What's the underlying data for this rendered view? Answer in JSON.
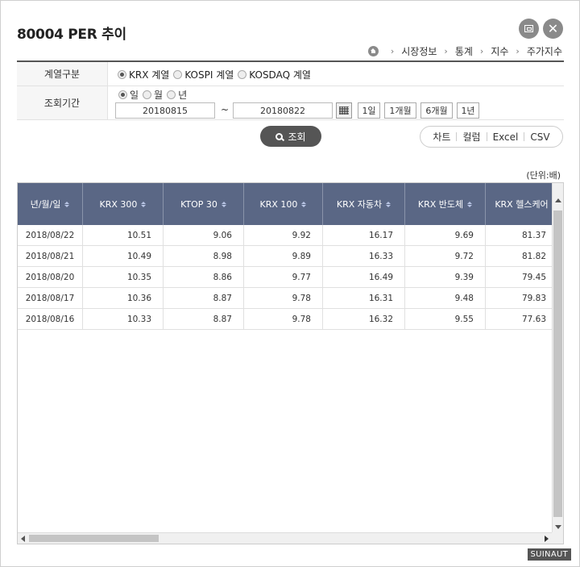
{
  "window": {
    "title": "80004 PER 추이",
    "restore_icon": "restore-icon",
    "close_icon": "close-icon",
    "close_glyph": "✕"
  },
  "breadcrumb": {
    "separator": "›",
    "items": [
      "시장정보",
      "통계",
      "지수",
      "주가지수"
    ]
  },
  "form": {
    "series_label": "계열구분",
    "series_options": [
      {
        "label": "KRX 계열",
        "selected": true
      },
      {
        "label": "KOSPI 계열",
        "selected": false
      },
      {
        "label": "KOSDAQ 계열",
        "selected": false
      }
    ],
    "period_label": "조회기간",
    "period_options": [
      {
        "label": "일",
        "selected": true
      },
      {
        "label": "월",
        "selected": false
      },
      {
        "label": "년",
        "selected": false
      }
    ],
    "start_date": "20180815",
    "tilde": "~",
    "end_date": "20180822",
    "quick_buttons": [
      "1일",
      "1개월",
      "6개월",
      "1년"
    ]
  },
  "search_label": "조회",
  "tools": [
    "차트",
    "컬럼",
    "Excel",
    "CSV"
  ],
  "unit": "(단위:배)",
  "table": {
    "headers": [
      "년/월/일",
      "KRX 300",
      "KTOP 30",
      "KRX 100",
      "KRX 자동차",
      "KRX 반도체",
      "KRX 헬스케어"
    ],
    "rows": [
      [
        "2018/08/22",
        "10.51",
        "9.06",
        "9.92",
        "16.17",
        "9.69",
        "81.37"
      ],
      [
        "2018/08/21",
        "10.49",
        "8.98",
        "9.89",
        "16.33",
        "9.72",
        "81.82"
      ],
      [
        "2018/08/20",
        "10.35",
        "8.86",
        "9.77",
        "16.49",
        "9.39",
        "79.45"
      ],
      [
        "2018/08/17",
        "10.36",
        "8.87",
        "9.78",
        "16.31",
        "9.48",
        "79.83"
      ],
      [
        "2018/08/16",
        "10.33",
        "8.87",
        "9.78",
        "16.32",
        "9.55",
        "77.63"
      ]
    ]
  },
  "badge": "SUINAUT",
  "colors": {
    "header_bg": "#5a6785",
    "search_btn": "#555555"
  }
}
